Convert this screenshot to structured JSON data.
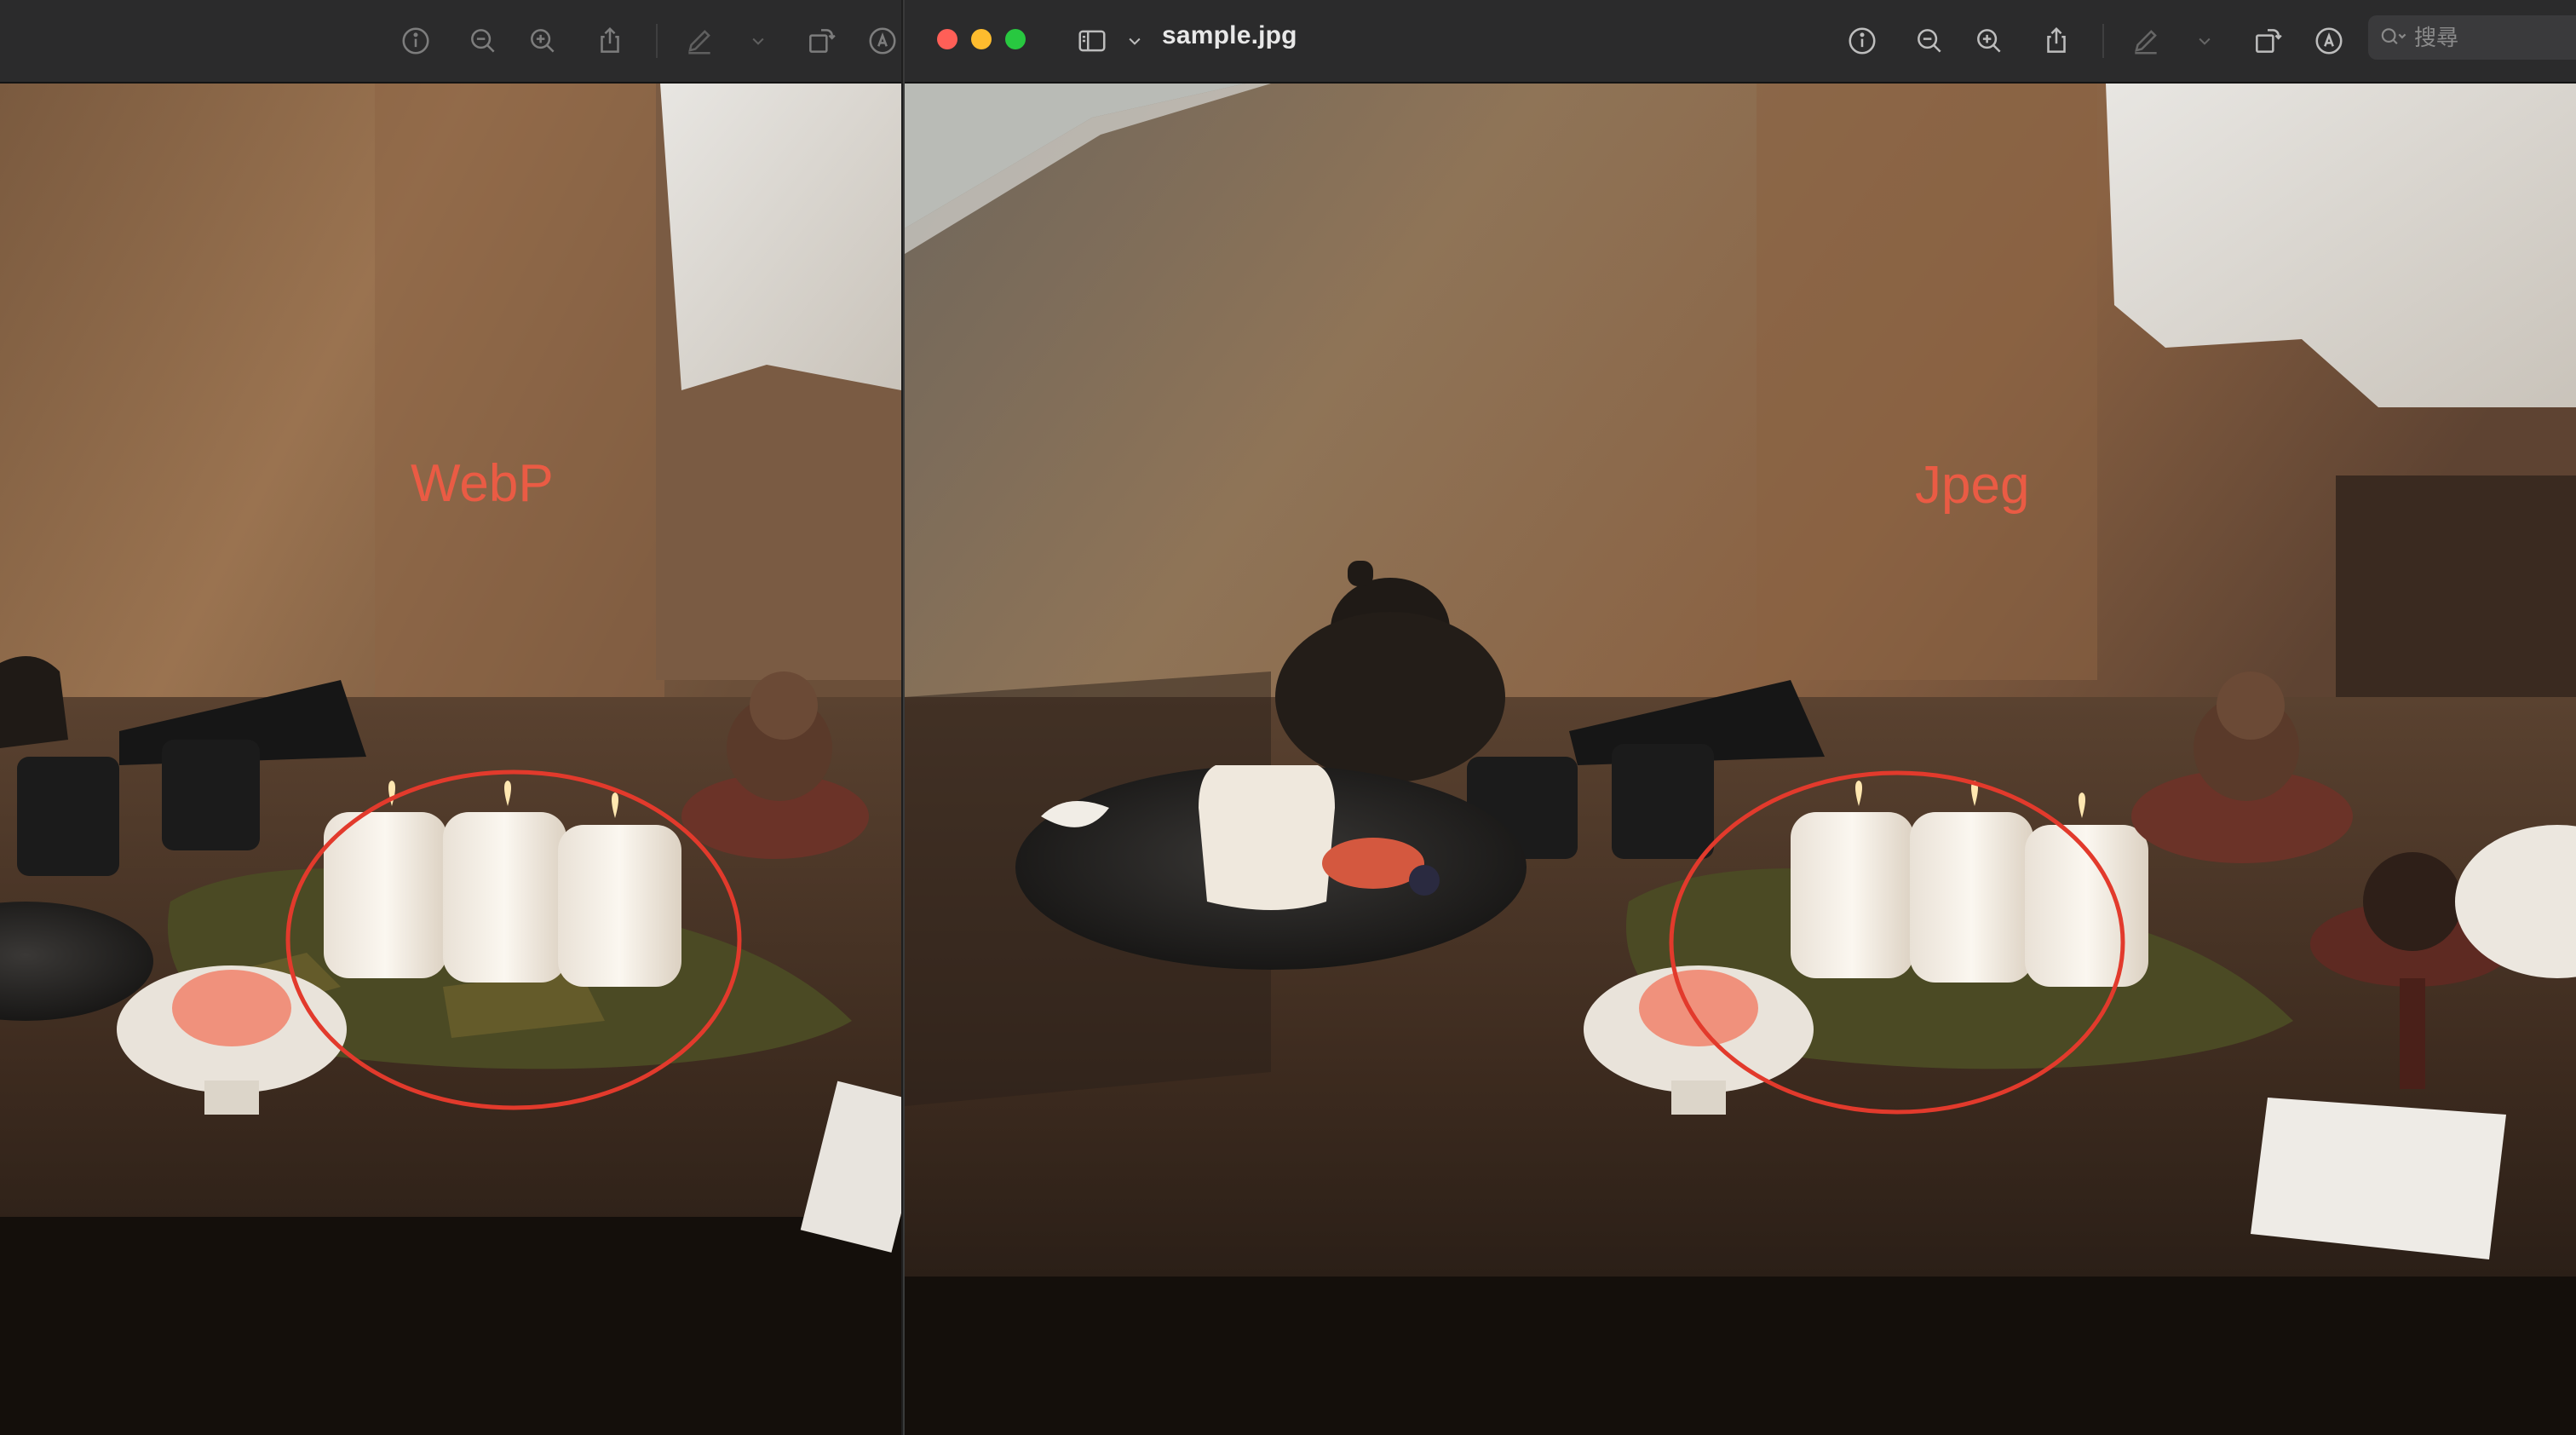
{
  "left_window": {
    "toolbar": {
      "buttons": [
        "info-icon",
        "zoom-out-icon",
        "zoom-in-icon",
        "share-icon",
        "markup-pen-icon",
        "chevron-down-icon",
        "rotate-icon",
        "annotate-icon"
      ]
    },
    "annotation_label": "WebP"
  },
  "right_window": {
    "title": "sample.jpg",
    "toolbar": {
      "buttons": [
        "sidebar-toggle-icon",
        "chevron-down-icon",
        "info-icon",
        "zoom-out-icon",
        "zoom-in-icon",
        "share-icon",
        "markup-pen-icon",
        "chevron-down-icon",
        "rotate-icon",
        "annotate-icon"
      ]
    },
    "search": {
      "placeholder": "搜尋"
    },
    "annotation_label": "Jpeg"
  },
  "colors": {
    "toolbar_bg": "#2b2b2c",
    "annotation_red": "#e23a2c",
    "traffic_close": "#ff5f57",
    "traffic_minimize": "#febc2e",
    "traffic_zoom": "#28c840"
  }
}
